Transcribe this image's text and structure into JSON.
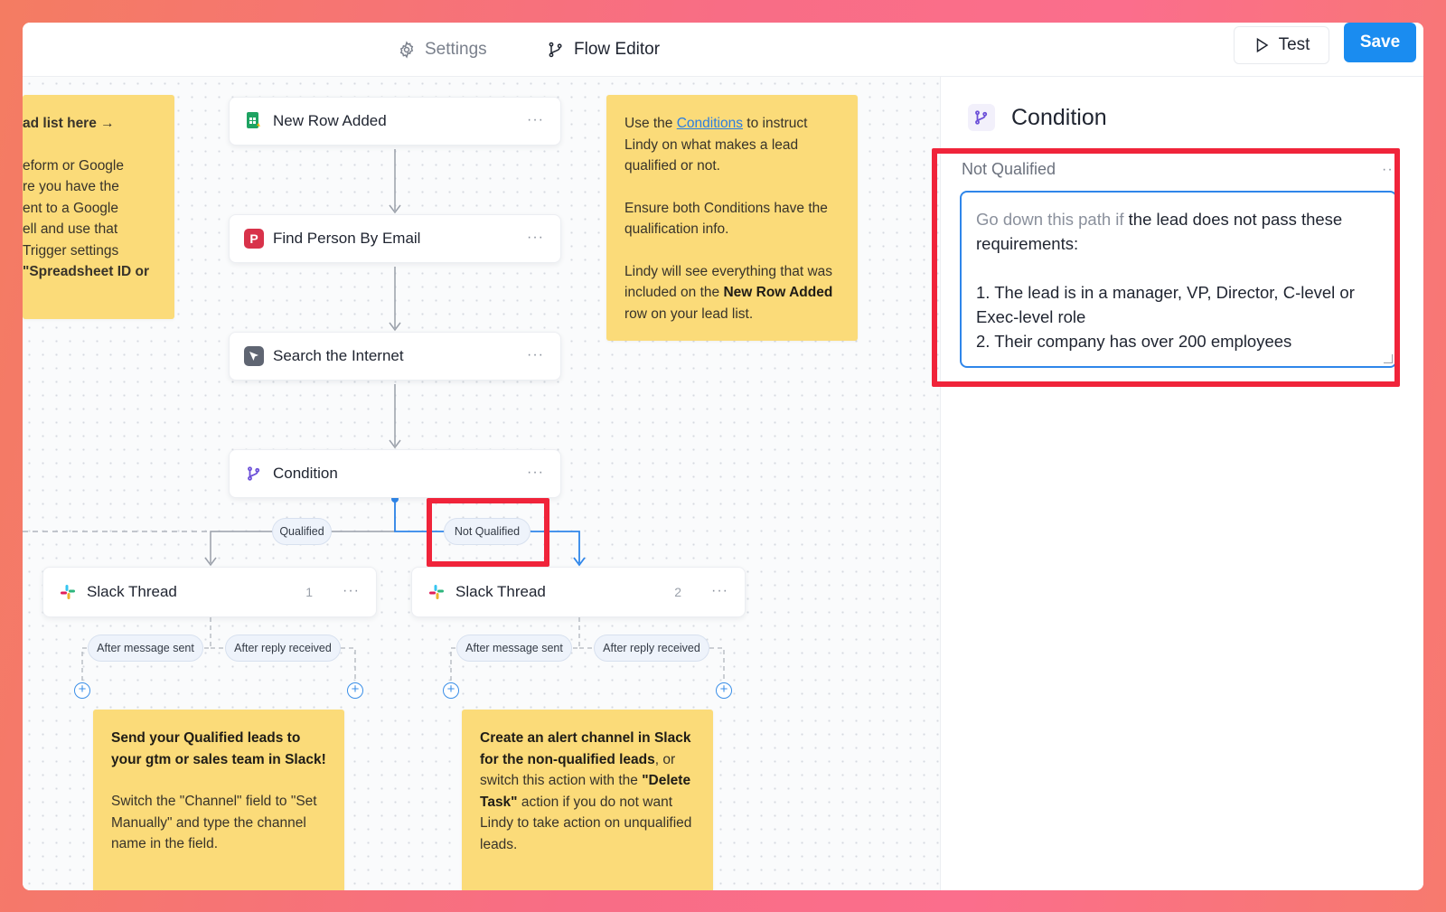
{
  "topbar": {
    "settings_label": "Settings",
    "flow_editor_label": "Flow Editor",
    "test_label": "Test",
    "save_label": "Save"
  },
  "canvas": {
    "nodes": [
      {
        "label": "New Row Added",
        "icon": "google-sheets-icon"
      },
      {
        "label": "Find Person By Email",
        "icon": "p-app-icon"
      },
      {
        "label": "Search the Internet",
        "icon": "browser-icon"
      },
      {
        "label": "Condition",
        "icon": "condition-branch-icon"
      },
      {
        "label": "Slack Thread",
        "icon": "slack-icon",
        "badge": "1"
      },
      {
        "label": "Slack Thread",
        "icon": "slack-icon",
        "badge": "2"
      }
    ],
    "branch_pills": {
      "qualified": "Qualified",
      "not_qualified": "Not Qualified"
    },
    "event_pills": {
      "after_message_sent": "After message sent",
      "after_reply_received": "After reply received"
    },
    "note_left": {
      "line1": "ad list here →",
      "line2": "eform or Google",
      "line3": "re you have the",
      "line4": "ent to a Google",
      "line5": "ell and use that",
      "line6": "Trigger settings",
      "line7": "\"Spreadsheet ID or"
    },
    "note_top": {
      "p1_a": "Use the ",
      "p1_link": "Conditions",
      "p1_b": " to instruct Lindy on what makes a lead qualified or not.",
      "p2": "Ensure both Conditions have the qualification info.",
      "p3_a": "Lindy will see everything that was included on the ",
      "p3_bold": "New Row Added",
      "p3_b": " row on your lead list."
    },
    "note_bottom_left": {
      "bold": "Send your Qualified leads to your gtm or sales team in Slack!",
      "body": "Switch the \"Channel\" field to \"Set Manually\" and type the channel name in the field."
    },
    "note_bottom_right": {
      "bold1": "Create an alert channel in Slack for the non-qualified leads",
      "mid1": ", or switch this action with the ",
      "bold2": "\"Delete Task\"",
      "mid2": " action if you do not want Lindy to take action on unqualified leads."
    }
  },
  "panel": {
    "title": "Condition",
    "card_label": "Not Qualified",
    "placeholder_prefix": "Go down this path if",
    "text_line1": " the lead does not pass these requirements:",
    "text_line2": "1. The lead is in a manager, VP, Director, C-level or Exec-level role",
    "text_line3": "2. Their company has over 200 employees"
  },
  "colors": {
    "accent": "#1a8cf0",
    "highlight": "#f0243a",
    "note": "#fbdb79"
  }
}
